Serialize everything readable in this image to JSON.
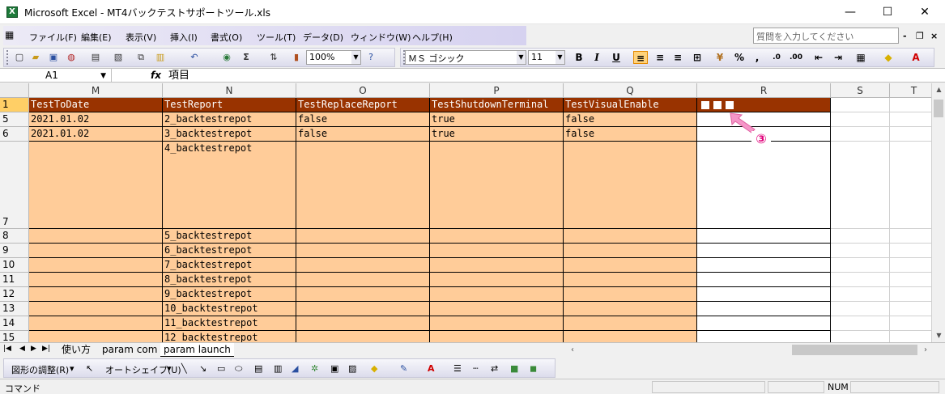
{
  "window": {
    "title": "Microsoft Excel - MT4バックテストサポートツール.xls",
    "app_icon_letter": "X",
    "minimize_glyph": "—",
    "maximize_glyph": "☐",
    "close_glyph": "✕"
  },
  "menu": {
    "items": [
      "ファイル(F)",
      "編集(E)",
      "表示(V)",
      "挿入(I)",
      "書式(O)",
      "ツール(T)",
      "データ(D)",
      "ウィンドウ(W)",
      "ヘルプ(H)"
    ],
    "ask_placeholder": "質問を入力してください",
    "mdi_min": "-",
    "mdi_restore": "❐",
    "mdi_close": "×"
  },
  "toolbar": {
    "zoom": "100%",
    "font_name": "ＭＳ ゴシック",
    "font_size": "11",
    "bold": "B",
    "italic": "I",
    "underline": "U",
    "percent": "%",
    "comma": ",",
    "sum": "Σ",
    "help": "?"
  },
  "formula_bar": {
    "name_box": "A1",
    "fx": "fx",
    "content": "項目"
  },
  "grid": {
    "columns": [
      "M",
      "N",
      "O",
      "P",
      "Q",
      "R",
      "S",
      "T"
    ],
    "rows": [
      "1",
      "5",
      "6",
      "7",
      "8",
      "9",
      "10",
      "11",
      "12",
      "13",
      "14",
      "15"
    ],
    "header_row": [
      "TestToDate",
      "TestReport",
      "TestReplaceReport",
      "TestShutdownTerminal",
      "TestVisualEnable"
    ],
    "data": [
      [
        "2021.01.02",
        "2_backtestrepot",
        "false",
        "true",
        "false"
      ],
      [
        "2021.01.02",
        "3_backtestrepot",
        "false",
        "true",
        "false"
      ],
      [
        "",
        "4_backtestrepot",
        "",
        "",
        ""
      ],
      [
        "",
        "5_backtestrepot",
        "",
        "",
        ""
      ],
      [
        "",
        "6_backtestrepot",
        "",
        "",
        ""
      ],
      [
        "",
        "7_backtestrepot",
        "",
        "",
        ""
      ],
      [
        "",
        "8_backtestrepot",
        "",
        "",
        ""
      ],
      [
        "",
        "9_backtestrepot",
        "",
        "",
        ""
      ],
      [
        "",
        "10_backtestrepot",
        "",
        "",
        ""
      ],
      [
        "",
        "11_backtestrepot",
        "",
        "",
        ""
      ],
      [
        "",
        "12_backtestrepot",
        "",
        "",
        ""
      ]
    ],
    "colors": {
      "header_bg": "#993300",
      "data_bg": "#ffcc99"
    }
  },
  "annotation": {
    "badge": "③",
    "arrow_color": "#f080c0"
  },
  "sheets": {
    "tabs": [
      "使い方",
      "param com",
      "param launch"
    ],
    "active": 2,
    "nav_glyphs": [
      "◀",
      "◀",
      "▶",
      "▶"
    ]
  },
  "drawing_toolbar": {
    "adjust": "図形の調整(R)",
    "autoshape": "オートシェイプ(U)"
  },
  "status": {
    "mode": "コマンド",
    "num": "NUM"
  }
}
